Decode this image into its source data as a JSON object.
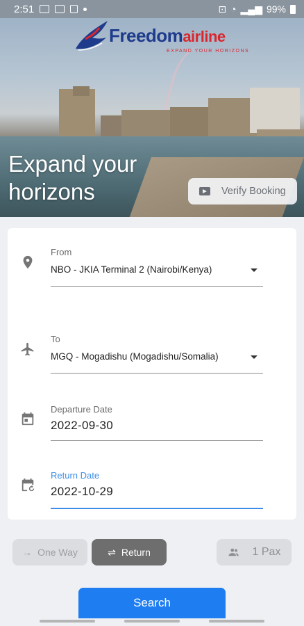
{
  "status_bar": {
    "time": "2:51",
    "battery": "99%"
  },
  "brand": {
    "name_main": "Freedom",
    "name_accent": "airline",
    "tagline": "EXPAND YOUR HORIZONS"
  },
  "hero": {
    "title_line1": "Expand your",
    "title_line2": "horizons",
    "verify_label": "Verify Booking"
  },
  "form": {
    "from": {
      "label": "From",
      "value": "NBO - JKIA Terminal 2 (Nairobi/Kenya)"
    },
    "to": {
      "label": "To",
      "value": "MGQ - Mogadishu (Mogadishu/Somalia)"
    },
    "departure": {
      "label": "Departure Date",
      "value": "2022-09-30"
    },
    "return": {
      "label": "Return Date",
      "value": "2022-10-29"
    }
  },
  "trip_type": {
    "one_way": "One Way",
    "return": "Return",
    "selected": "return"
  },
  "pax": {
    "label": "1 Pax"
  },
  "search": {
    "label": "Search"
  },
  "colors": {
    "brand_blue": "#1f3b8c",
    "brand_red": "#d9272e",
    "primary": "#1e7df0",
    "active_field": "#3b8ee8"
  },
  "icons": [
    "location-pin-icon",
    "airplane-icon",
    "calendar-icon",
    "calendar-return-icon",
    "video-icon",
    "swap-arrows-icon",
    "arrow-right-icon",
    "people-icon"
  ]
}
